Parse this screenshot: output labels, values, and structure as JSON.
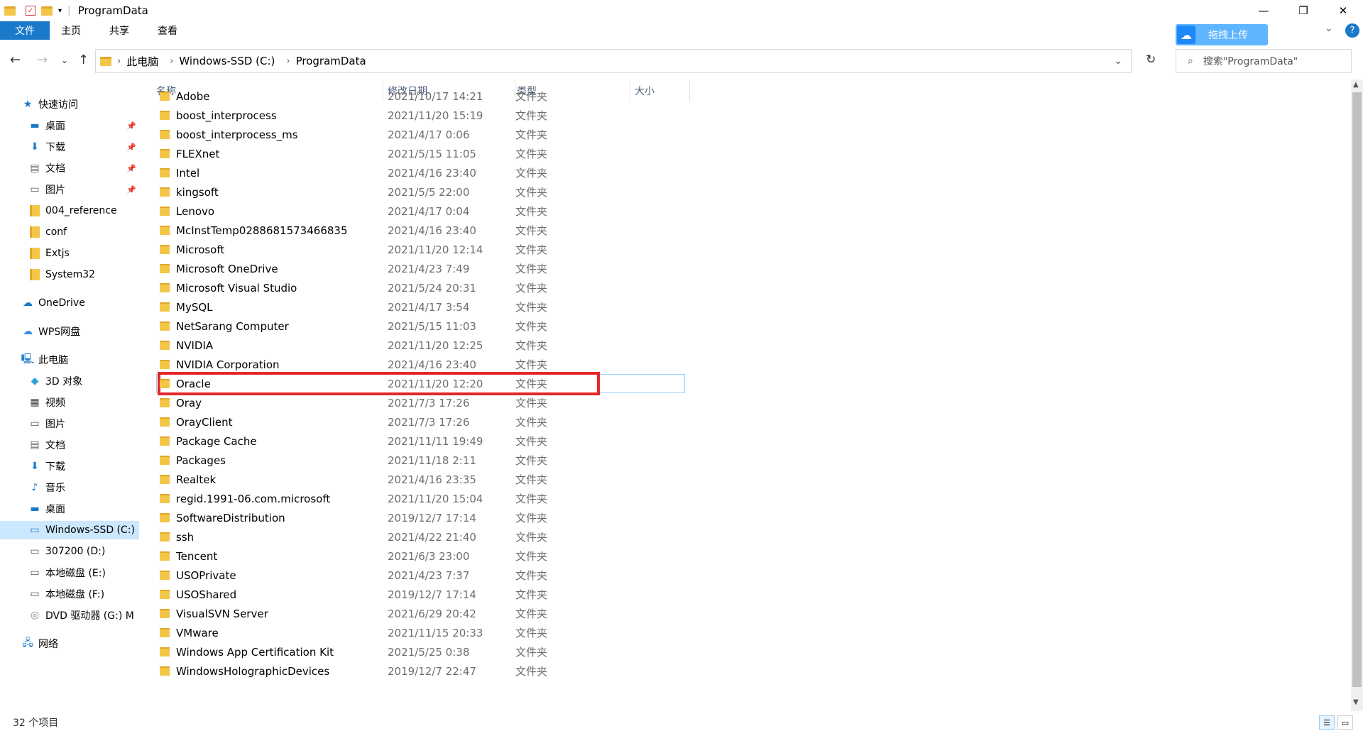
{
  "window": {
    "title": "ProgramData",
    "minimize": "—",
    "maximize": "❐",
    "close": "✕"
  },
  "ribbon": {
    "tabs": [
      "文件",
      "主页",
      "共享",
      "查看"
    ],
    "upload_label": "拖拽上传",
    "help": "?"
  },
  "address": {
    "breadcrumbs": [
      "此电脑",
      "Windows-SSD (C:)",
      "ProgramData"
    ],
    "search_placeholder": "搜索\"ProgramData\""
  },
  "sidebar": {
    "quick_access": "快速访问",
    "quick_items": [
      {
        "label": "桌面",
        "icon": "desktop-icon",
        "pinned": true
      },
      {
        "label": "下载",
        "icon": "download-icon",
        "pinned": true
      },
      {
        "label": "文档",
        "icon": "document-icon",
        "pinned": true
      },
      {
        "label": "图片",
        "icon": "picture-icon",
        "pinned": true
      },
      {
        "label": "004_reference",
        "icon": "folder-icon",
        "pinned": false
      },
      {
        "label": "conf",
        "icon": "folder-icon",
        "pinned": false
      },
      {
        "label": "Extjs",
        "icon": "folder-icon",
        "pinned": false
      },
      {
        "label": "System32",
        "icon": "folder-icon",
        "pinned": false
      }
    ],
    "onedrive": "OneDrive",
    "wps": "WPS网盘",
    "this_pc": "此电脑",
    "pc_items": [
      {
        "label": "3D 对象",
        "icon": "3d-objects-icon"
      },
      {
        "label": "视频",
        "icon": "video-icon"
      },
      {
        "label": "图片",
        "icon": "picture-icon"
      },
      {
        "label": "文档",
        "icon": "document-icon"
      },
      {
        "label": "下载",
        "icon": "download-icon"
      },
      {
        "label": "音乐",
        "icon": "music-icon"
      },
      {
        "label": "桌面",
        "icon": "desktop-icon"
      },
      {
        "label": "Windows-SSD (C:)",
        "icon": "drive-icon",
        "selected": true
      },
      {
        "label": "307200 (D:)",
        "icon": "drive-icon"
      },
      {
        "label": "本地磁盘 (E:)",
        "icon": "drive-icon"
      },
      {
        "label": "本地磁盘 (F:)",
        "icon": "drive-icon"
      },
      {
        "label": "DVD 驱动器 (G:) M",
        "icon": "dvd-icon"
      }
    ],
    "network": "网络"
  },
  "columns": {
    "name": "名称",
    "date": "修改日期",
    "type": "类型",
    "size": "大小"
  },
  "files": [
    {
      "name": "Adobe",
      "date": "2021/10/17 14:21",
      "type": "文件夹"
    },
    {
      "name": "boost_interprocess",
      "date": "2021/11/20 15:19",
      "type": "文件夹"
    },
    {
      "name": "boost_interprocess_ms",
      "date": "2021/4/17 0:06",
      "type": "文件夹"
    },
    {
      "name": "FLEXnet",
      "date": "2021/5/15 11:05",
      "type": "文件夹"
    },
    {
      "name": "Intel",
      "date": "2021/4/16 23:40",
      "type": "文件夹"
    },
    {
      "name": "kingsoft",
      "date": "2021/5/5 22:00",
      "type": "文件夹"
    },
    {
      "name": "Lenovo",
      "date": "2021/4/17 0:04",
      "type": "文件夹"
    },
    {
      "name": "McInstTemp0288681573466835",
      "date": "2021/4/16 23:40",
      "type": "文件夹"
    },
    {
      "name": "Microsoft",
      "date": "2021/11/20 12:14",
      "type": "文件夹"
    },
    {
      "name": "Microsoft OneDrive",
      "date": "2021/4/23 7:49",
      "type": "文件夹"
    },
    {
      "name": "Microsoft Visual Studio",
      "date": "2021/5/24 20:31",
      "type": "文件夹"
    },
    {
      "name": "MySQL",
      "date": "2021/4/17 3:54",
      "type": "文件夹"
    },
    {
      "name": "NetSarang Computer",
      "date": "2021/5/15 11:03",
      "type": "文件夹"
    },
    {
      "name": "NVIDIA",
      "date": "2021/11/20 12:25",
      "type": "文件夹"
    },
    {
      "name": "NVIDIA Corporation",
      "date": "2021/4/16 23:40",
      "type": "文件夹"
    },
    {
      "name": "Oracle",
      "date": "2021/11/20 12:20",
      "type": "文件夹",
      "highlighted": true
    },
    {
      "name": "Oray",
      "date": "2021/7/3 17:26",
      "type": "文件夹"
    },
    {
      "name": "OrayClient",
      "date": "2021/7/3 17:26",
      "type": "文件夹"
    },
    {
      "name": "Package Cache",
      "date": "2021/11/11 19:49",
      "type": "文件夹"
    },
    {
      "name": "Packages",
      "date": "2021/11/18 2:11",
      "type": "文件夹"
    },
    {
      "name": "Realtek",
      "date": "2021/4/16 23:35",
      "type": "文件夹"
    },
    {
      "name": "regid.1991-06.com.microsoft",
      "date": "2021/11/20 15:04",
      "type": "文件夹"
    },
    {
      "name": "SoftwareDistribution",
      "date": "2019/12/7 17:14",
      "type": "文件夹"
    },
    {
      "name": "ssh",
      "date": "2021/4/22 21:40",
      "type": "文件夹"
    },
    {
      "name": "Tencent",
      "date": "2021/6/3 23:00",
      "type": "文件夹"
    },
    {
      "name": "USOPrivate",
      "date": "2021/4/23 7:37",
      "type": "文件夹"
    },
    {
      "name": "USOShared",
      "date": "2019/12/7 17:14",
      "type": "文件夹"
    },
    {
      "name": "VisualSVN Server",
      "date": "2021/6/29 20:42",
      "type": "文件夹"
    },
    {
      "name": "VMware",
      "date": "2021/11/15 20:33",
      "type": "文件夹"
    },
    {
      "name": "Windows App Certification Kit",
      "date": "2021/5/25 0:38",
      "type": "文件夹"
    },
    {
      "name": "WindowsHolographicDevices",
      "date": "2019/12/7 22:47",
      "type": "文件夹"
    }
  ],
  "status": {
    "count": "32 个项目"
  }
}
